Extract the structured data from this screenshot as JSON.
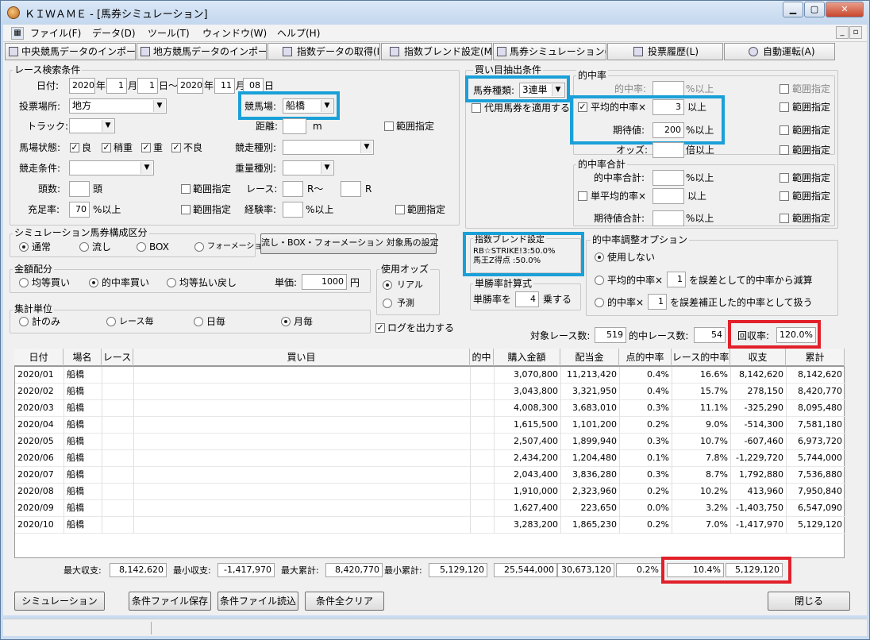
{
  "window": {
    "title": "ＫＩＷＡＭＥ - [馬券シミュレーション]"
  },
  "menu": [
    "ファイル(F)",
    "データ(D)",
    "ツール(T)",
    "ウィンドウ(W)",
    "ヘルプ(H)"
  ],
  "toolbar": [
    "中央競馬データのインポート(J)",
    "地方競馬データのインポート(N)",
    "指数データの取得(I)",
    "指数ブレンド設定(M)",
    "馬券シミュレーション(B)",
    "投票履歴(L)",
    "自動運転(A)"
  ],
  "race": {
    "group": "レース検索条件",
    "date_label": "日付:",
    "from_year": "2020",
    "from_month": "1",
    "from_day": "1",
    "to_year": "2020",
    "to_month": "11",
    "to_day": "08",
    "year": "年",
    "month": "月",
    "day": "日",
    "tilde": "日～",
    "venue_label": "投票場所:",
    "venue": "地方",
    "track_course_label": "競馬場:",
    "track_course": "船橋",
    "track_label": "トラック:",
    "distance_label": "距離:",
    "m": "m",
    "range": "範囲指定",
    "cond_label": "馬場状態:",
    "cond": [
      "良",
      "稍重",
      "重",
      "不良"
    ],
    "race_type_label": "競走種別:",
    "race_cond_label": "競走条件:",
    "weight_type_label": "重量種別:",
    "heads_label": "頭数:",
    "heads_unit": "頭",
    "race_label": "レース:",
    "R_tilde": "R～",
    "R": "R",
    "fill_label": "充足率:",
    "fill": "70",
    "fill_unit": "%以上",
    "exp_label": "経験率:",
    "exp_unit": "%以上"
  },
  "sim": {
    "group": "シミュレーション馬券構成区分",
    "opts": [
      "通常",
      "流し",
      "BOX",
      "フォーメーション"
    ],
    "target_btn": "流し・BOX・フォーメーション 対象馬の設定"
  },
  "amount": {
    "group": "金額配分",
    "opts": [
      "均等買い",
      "的中率買い",
      "均等払い戻し"
    ],
    "price_label": "単価:",
    "price": "1000",
    "yen": "円"
  },
  "odds": {
    "group": "使用オッズ",
    "opts": [
      "リアル",
      "予測"
    ]
  },
  "agg": {
    "group": "集計単位",
    "opts": [
      "計のみ",
      "レース毎",
      "日毎",
      "月毎"
    ]
  },
  "log": "ログを出力する",
  "buy": {
    "group": "買い目抽出条件",
    "type_label": "馬券種類:",
    "type": "3連単",
    "substitute": "代用馬券を適用する",
    "hit_group": "的中率",
    "hit_label": "的中率:",
    "pct_above": "%以上",
    "avg_hit_label": "平均的中率×",
    "avg_hit": "3",
    "above": "以上",
    "ev_label": "期待値:",
    "ev": "200",
    "odds_label": "オッズ:",
    "odds_unit": "倍以上",
    "sum_group": "的中率合計",
    "sum_hit_label": "的中率合計:",
    "single_avg_label": "単平均的率×",
    "ev_sum_label": "期待値合計:",
    "range": "範囲指定"
  },
  "blend": {
    "group": "指数ブレンド設定",
    "lines": [
      "RB☆STRIKE!3:50.0%",
      "馬王Z得点 :50.0%"
    ]
  },
  "win_calc": {
    "group": "単勝率計算式",
    "prefix": "単勝率を",
    "mult": "4",
    "suffix": "乗する"
  },
  "adjust": {
    "group": "的中率調整オプション",
    "opt1": "使用しない",
    "opt2a": "平均的中率×",
    "opt2v": "1",
    "opt2b": "を誤差として的中率から減算",
    "opt3a": "的中率×",
    "opt3v": "1",
    "opt3b": "を誤差補正した的中率として扱う"
  },
  "summary": {
    "races_label": "対象レース数:",
    "races": "519",
    "hits_label": "的中レース数:",
    "hits": "54",
    "recovery_label": "回収率:",
    "recovery": "120.0%"
  },
  "grid": {
    "headers": [
      "日付",
      "場名",
      "レース",
      "買い目",
      "的中",
      "購入金額",
      "配当金",
      "点的中率",
      "レース的中率",
      "収支",
      "累計"
    ],
    "rows": [
      [
        "2020/01",
        "船橋",
        "",
        "",
        "",
        "3,070,800",
        "11,213,420",
        "0.4%",
        "16.6%",
        "8,142,620",
        "8,142,620"
      ],
      [
        "2020/02",
        "船橋",
        "",
        "",
        "",
        "3,043,800",
        "3,321,950",
        "0.4%",
        "15.7%",
        "278,150",
        "8,420,770"
      ],
      [
        "2020/03",
        "船橋",
        "",
        "",
        "",
        "4,008,300",
        "3,683,010",
        "0.3%",
        "11.1%",
        "-325,290",
        "8,095,480"
      ],
      [
        "2020/04",
        "船橋",
        "",
        "",
        "",
        "1,615,500",
        "1,101,200",
        "0.2%",
        "9.0%",
        "-514,300",
        "7,581,180"
      ],
      [
        "2020/05",
        "船橋",
        "",
        "",
        "",
        "2,507,400",
        "1,899,940",
        "0.3%",
        "10.7%",
        "-607,460",
        "6,973,720"
      ],
      [
        "2020/06",
        "船橋",
        "",
        "",
        "",
        "2,434,200",
        "1,204,480",
        "0.1%",
        "7.8%",
        "-1,229,720",
        "5,744,000"
      ],
      [
        "2020/07",
        "船橋",
        "",
        "",
        "",
        "2,043,400",
        "3,836,280",
        "0.3%",
        "8.7%",
        "1,792,880",
        "7,536,880"
      ],
      [
        "2020/08",
        "船橋",
        "",
        "",
        "",
        "1,910,000",
        "2,323,960",
        "0.2%",
        "10.2%",
        "413,960",
        "7,950,840"
      ],
      [
        "2020/09",
        "船橋",
        "",
        "",
        "",
        "1,627,400",
        "223,650",
        "0.0%",
        "3.2%",
        "-1,403,750",
        "6,547,090"
      ],
      [
        "2020/10",
        "船橋",
        "",
        "",
        "",
        "3,283,200",
        "1,865,230",
        "0.2%",
        "7.0%",
        "-1,417,970",
        "5,129,120"
      ]
    ]
  },
  "totals": {
    "max_income_label": "最大収支:",
    "max_income": "8,142,620",
    "min_income_label": "最小収支:",
    "min_income": "-1,417,970",
    "max_cum_label": "最大累計:",
    "max_cum": "8,420,770",
    "min_cum_label": "最小累計:",
    "min_cum": "5,129,120",
    "purchase": "25,544,000",
    "payout": "30,673,120",
    "point_hit": "0.2%",
    "race_hit": "10.4%",
    "balance": "5,129,120"
  },
  "buttons": {
    "simulate": "シミュレーション",
    "save": "条件ファイル保存",
    "load": "条件ファイル読込",
    "clear": "条件全クリア",
    "close": "閉じる"
  }
}
